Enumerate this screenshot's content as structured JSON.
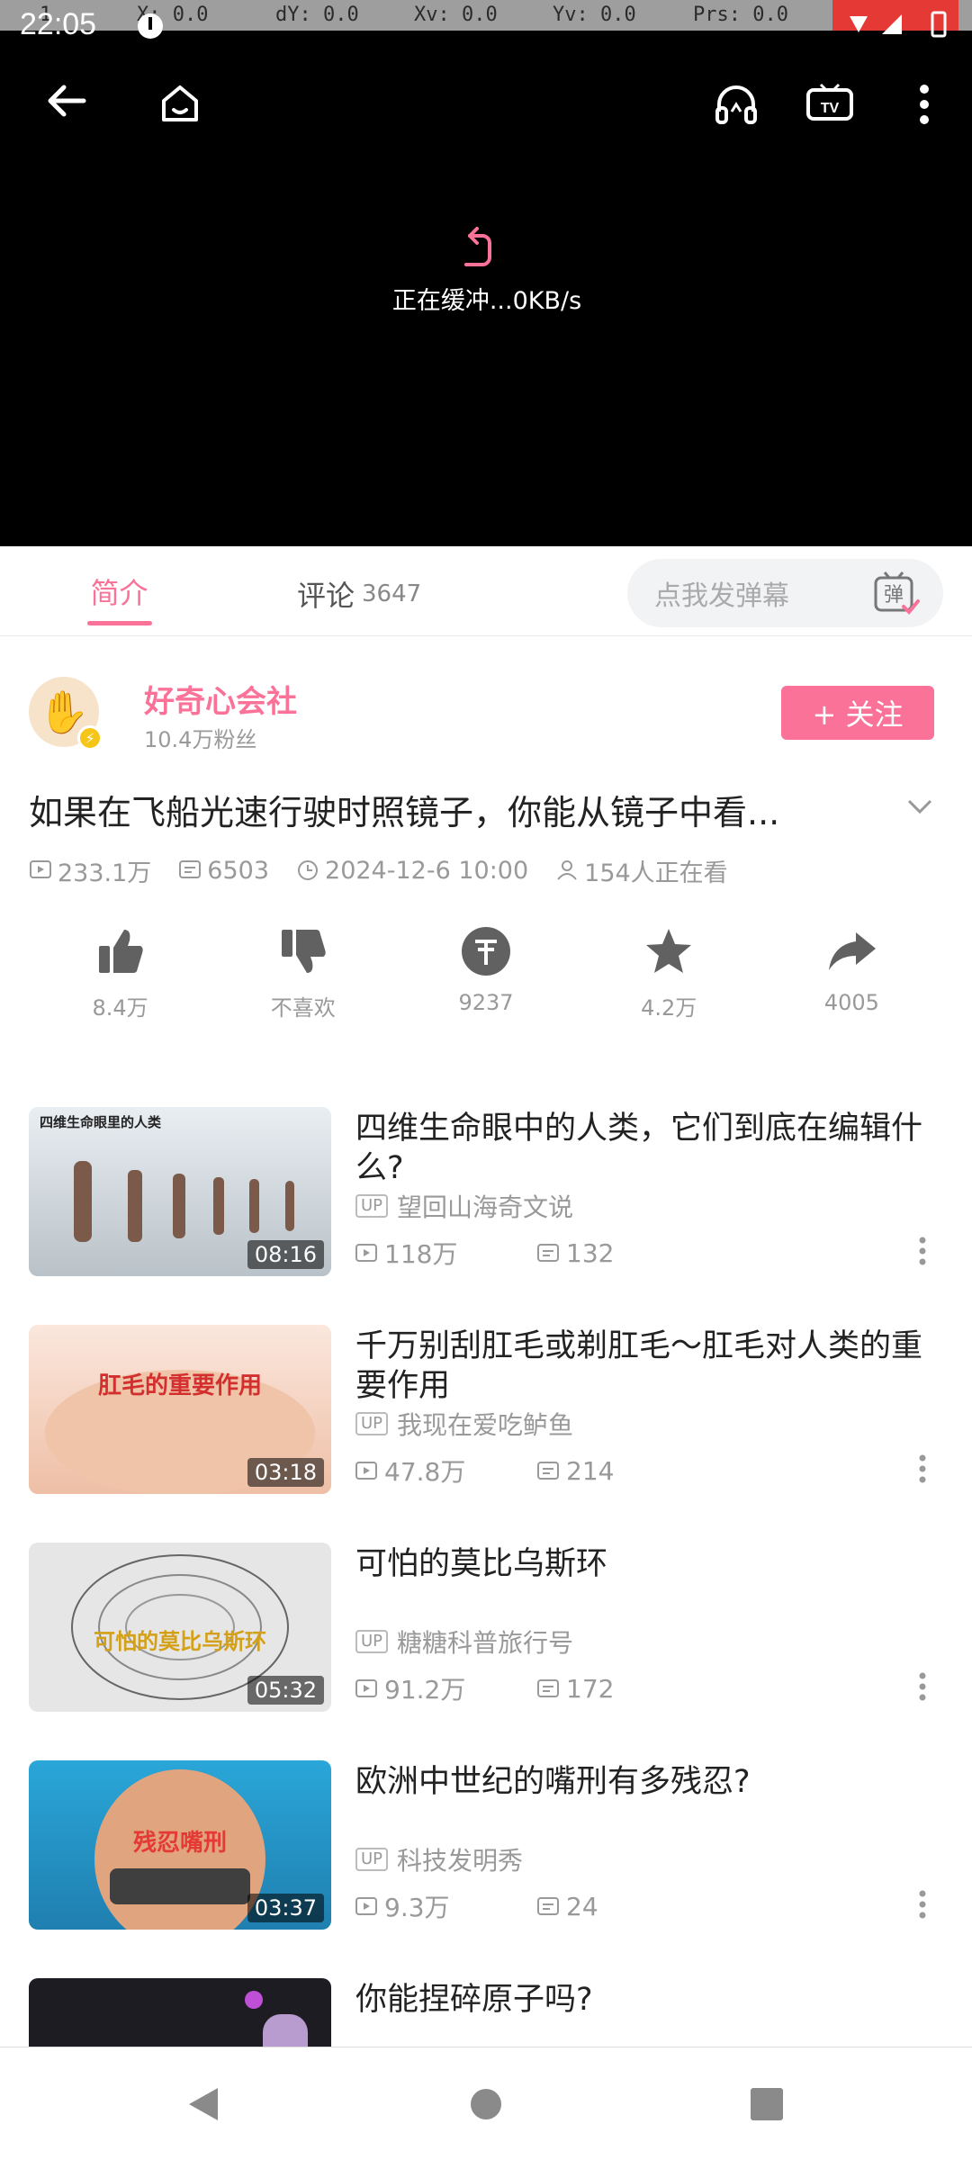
{
  "debug": {
    "p": "1",
    "x": "X: 0.0",
    "dy": "dY: 0.0",
    "xv": "Xv: 0.0",
    "yv": "Yv: 0.0",
    "prs": "Prs: 0.0"
  },
  "status": {
    "time": "22:05"
  },
  "player": {
    "buffer_text": "正在缓冲...0KB/s",
    "accent_color": "#fb7299"
  },
  "tabs": {
    "intro": "简介",
    "comments": "评论",
    "comments_count": "3647",
    "danmaku_placeholder": "点我发弹幕",
    "danmaku_toggle": "弹"
  },
  "uploader": {
    "name": "好奇心会社",
    "fans": "10.4万粉丝",
    "follow": "+ 关注"
  },
  "video": {
    "title": "如果在飞船光速行驶时照镜子，你能从镜子中看...",
    "views": "233.1万",
    "danmaku": "6503",
    "date": "2024-12-6 10:00",
    "watching": "154人正在看"
  },
  "actions": [
    {
      "name": "like",
      "label": "8.4万"
    },
    {
      "name": "dislike",
      "label": "不喜欢"
    },
    {
      "name": "coin",
      "label": "9237"
    },
    {
      "name": "favorite",
      "label": "4.2万"
    },
    {
      "name": "share",
      "label": "4005"
    }
  ],
  "recommendations": [
    {
      "title": "四维生命眼中的人类，它们到底在编辑什么?",
      "up": "望回山海奇文说",
      "views": "118万",
      "danmaku": "132",
      "duration": "08:16",
      "thumb_text": "四维生命眼里的人类"
    },
    {
      "title": "千万别刮肛毛或剃肛毛～肛毛对人类的重要作用",
      "up": "我现在爱吃鲈鱼",
      "views": "47.8万",
      "danmaku": "214",
      "duration": "03:18",
      "thumb_text": "肛毛的重要作用"
    },
    {
      "title": "可怕的莫比乌斯环",
      "up": "糖糖科普旅行号",
      "views": "91.2万",
      "danmaku": "172",
      "duration": "05:32",
      "thumb_text": "可怕的莫比乌斯环"
    },
    {
      "title": "欧洲中世纪的嘴刑有多残忍?",
      "up": "科技发明秀",
      "views": "9.3万",
      "danmaku": "24",
      "duration": "03:37",
      "thumb_text": "残忍嘴刑"
    },
    {
      "title": "你能捏碎原子吗?",
      "up": "",
      "views": "",
      "danmaku": "",
      "duration": "",
      "thumb_text": ""
    }
  ],
  "up_tag": "UP"
}
